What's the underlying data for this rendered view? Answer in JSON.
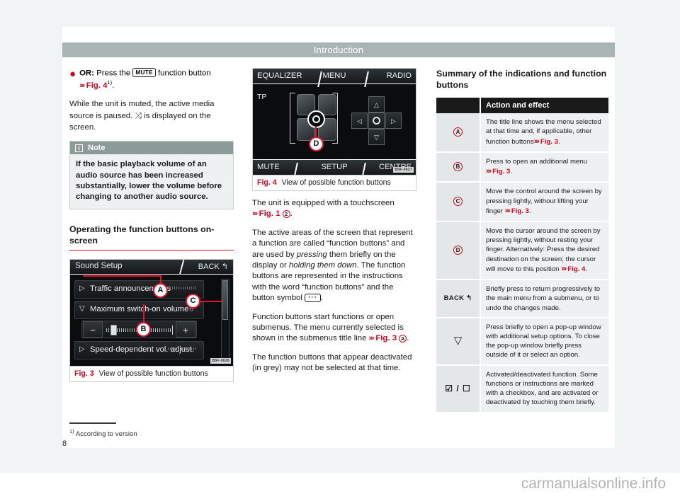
{
  "page": {
    "header_title": "Introduction",
    "page_number": "8",
    "watermark": "carmanualsonline.info"
  },
  "footnote": {
    "marker": "1)",
    "text": "According to version"
  },
  "col1": {
    "bullet": {
      "dot": "●",
      "or_label": "OR:",
      "text_before": "Press the",
      "keycap": "MUTE",
      "text_after": "function button",
      "xref_arrows": "›››",
      "xref": "Fig. 4",
      "footnote_marker": "1)"
    },
    "paragraph1_part1": "While the unit is muted, the active media source is paused.",
    "paragraph1_icon": "⤨",
    "paragraph1_part2": "is displayed on the screen.",
    "note": {
      "icon": "i",
      "title": "Note",
      "body": "If the basic playback volume of an audio source has been increased substantially, lower the volume before changing to another audio source."
    },
    "section_heading": "Operating the function buttons on-screen",
    "figure3": {
      "number": "Fig. 3",
      "caption": "View of possible function buttons",
      "id_code": "B5F-0626",
      "screen": {
        "title_left": "Sound Setup",
        "title_right": "BACK",
        "back_icon": "↰",
        "row1": "Traffic announcements",
        "row2": "Maximum switch-on volume",
        "row2_value": "6",
        "row3": "Speed-dependent vol. adjust.",
        "slider_minus": "−",
        "slider_plus": "+",
        "tri_right": "▷",
        "tri_down": "▽"
      },
      "callouts": [
        "A",
        "C",
        "B"
      ]
    }
  },
  "col2": {
    "figure4": {
      "number": "Fig. 4",
      "caption": "View of possible function buttons",
      "id_code": "B5F-0627",
      "screen": {
        "top_left": "EQUALIZER",
        "top_center": "MENU",
        "top_right": "RADIO",
        "bottom_left": "MUTE",
        "bottom_center": "SETUP",
        "bottom_right": "CENTRE",
        "tp_label": "TP",
        "dpad_up": "△",
        "dpad_down": "▽",
        "dpad_left": "◁",
        "dpad_right": "▷"
      },
      "callouts": [
        "D"
      ]
    },
    "p1_before": "The unit is equipped with a touchscreen",
    "p1_xref_arrows": "›››",
    "p1_xref": "Fig. 1",
    "p1_circle": "2",
    "p2_a": "The active areas of the screen that represent a function are called “function buttons” and are used by ",
    "p2_em1": "pressing",
    "p2_b": " them briefly on the display or ",
    "p2_em2": "holding them down",
    "p2_c": ". The function buttons are represented in the instructions with the word “function buttons” and the button symbol ",
    "p2_keycap": "···",
    "p2_d": ".",
    "p3_a": "Function buttons start functions or open submenus. The menu currently selected is shown in the submenus title line",
    "p3_xref_arrows": "›››",
    "p3_xref": "Fig. 3",
    "p3_circle": "A",
    "p4": "The function buttons that appear deactivated (in grey) may not be selected at that time."
  },
  "col3": {
    "table_heading": "Summary of the indications and function buttons",
    "columns": [
      "",
      "Action and effect"
    ],
    "rows": [
      {
        "key_type": "circle",
        "key": "A",
        "text": "The title line shows the menu selected at that time and, if applicable, other function buttons",
        "xref_arrows": "›››",
        "xref": "Fig. 3",
        "text_after": "."
      },
      {
        "key_type": "circle",
        "key": "B",
        "text": "Press to open an additional menu",
        "xref_arrows": "›››",
        "xref": "Fig. 3",
        "text_after": "."
      },
      {
        "key_type": "circle",
        "key": "C",
        "text": "Move the control around the screen by pressing lightly, without lifting your finger",
        "xref_arrows": "›››",
        "xref": "Fig. 3",
        "text_after": "."
      },
      {
        "key_type": "circle",
        "key": "D",
        "text": "Move the cursor around the screen by pressing lightly, without resting your finger. Alternatively: Press the desired destination on the screen; the cursor will move to this position",
        "xref_arrows": "›››",
        "xref": "Fig. 4",
        "text_after": "."
      },
      {
        "key_type": "back",
        "key": "BACK",
        "key_icon": "↰",
        "text": "Briefly press to return progressively to the main menu from a submenu, or to undo the changes made.",
        "xref_arrows": "",
        "xref": "",
        "text_after": ""
      },
      {
        "key_type": "triangle",
        "key": "▽",
        "text": "Press briefly to open a pop-up window with additional setup options. To close the pop-up window briefly press outside of it or select an option.",
        "xref_arrows": "",
        "xref": "",
        "text_after": ""
      },
      {
        "key_type": "checkbox",
        "key": "☑ / ☐",
        "text": "Activated/deactivated function. Some functions or instructions are marked with a checkbox, and are activated or deactivated by touching them briefly.",
        "xref_arrows": "",
        "xref": "",
        "text_after": ""
      }
    ]
  },
  "colors": {
    "accent_red": "#e8112d",
    "xref_red": "#d4021d",
    "header_band": "#a8b5b2",
    "note_head": "#8c9a98",
    "note_body": "#eef1f1",
    "table_header": "#1a1a1a",
    "table_key_bg": "#e3e7e8",
    "table_cell_bg": "#eef1f1",
    "page_bg": "#f1f4f4"
  }
}
